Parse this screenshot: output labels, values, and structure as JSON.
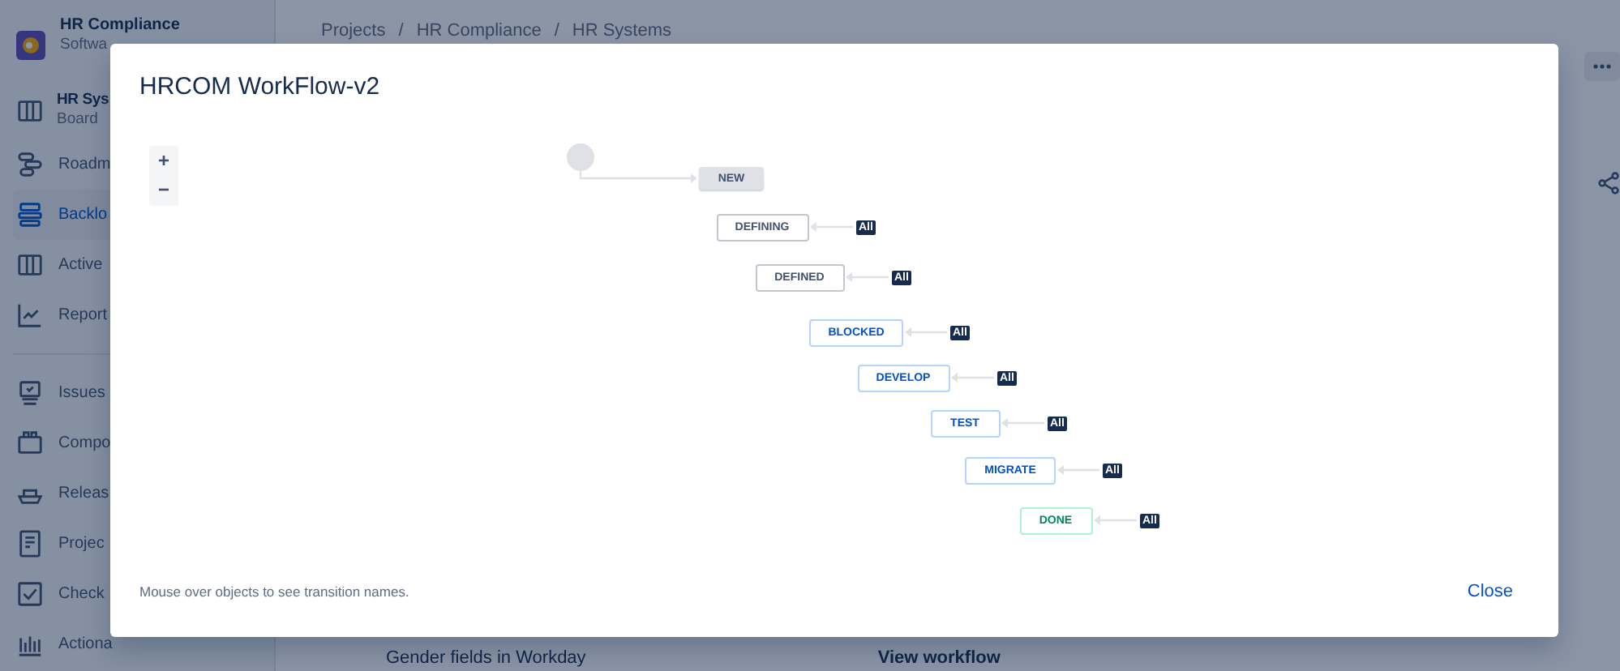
{
  "app": {
    "project": {
      "name": "HR Compliance",
      "subtitle": "Softwa"
    },
    "board": {
      "name": "HR Sys",
      "subtitle": "Board"
    },
    "nav": [
      {
        "label": "Roadm",
        "kind": "roadmap",
        "selected": false
      },
      {
        "label": "Backlo",
        "kind": "backlog",
        "selected": true
      },
      {
        "label": "Active",
        "kind": "board",
        "selected": false
      },
      {
        "label": "Report",
        "kind": "reports",
        "selected": false
      },
      {
        "label": "Issues",
        "kind": "issues",
        "selected": false,
        "section_start": true
      },
      {
        "label": "Compo",
        "kind": "components",
        "selected": false
      },
      {
        "label": "Releas",
        "kind": "releases",
        "selected": false
      },
      {
        "label": "Projec",
        "kind": "pages",
        "selected": false
      },
      {
        "label": "Check",
        "kind": "checklist",
        "selected": false
      },
      {
        "label": "Actiona",
        "kind": "insights",
        "selected": false
      }
    ],
    "breadcrumbs": [
      "Projects",
      "HR Compliance",
      "HR Systems"
    ],
    "breadcrumb_separator": "/",
    "rows": [
      {
        "summary": "Gender fields in Workday"
      }
    ],
    "side_panel": {
      "link": "View workflow"
    }
  },
  "dialog": {
    "title": "HRCOM WorkFlow-v2",
    "statuses": [
      {
        "name": "NEW",
        "kind": "initial"
      },
      {
        "name": "DEFINING",
        "kind": "todo",
        "badge": "All"
      },
      {
        "name": "DEFINED",
        "kind": "todo",
        "badge": "All"
      },
      {
        "name": "BLOCKED",
        "kind": "inprogress",
        "badge": "All"
      },
      {
        "name": "DEVELOP",
        "kind": "inprogress",
        "badge": "All"
      },
      {
        "name": "TEST",
        "kind": "inprogress",
        "badge": "All"
      },
      {
        "name": "MIGRATE",
        "kind": "inprogress",
        "badge": "All"
      },
      {
        "name": "DONE",
        "kind": "done",
        "badge": "All"
      }
    ],
    "zoom": {
      "in": "+",
      "out": "−"
    },
    "hint": "Mouse over objects to see transition names.",
    "close": "Close"
  }
}
